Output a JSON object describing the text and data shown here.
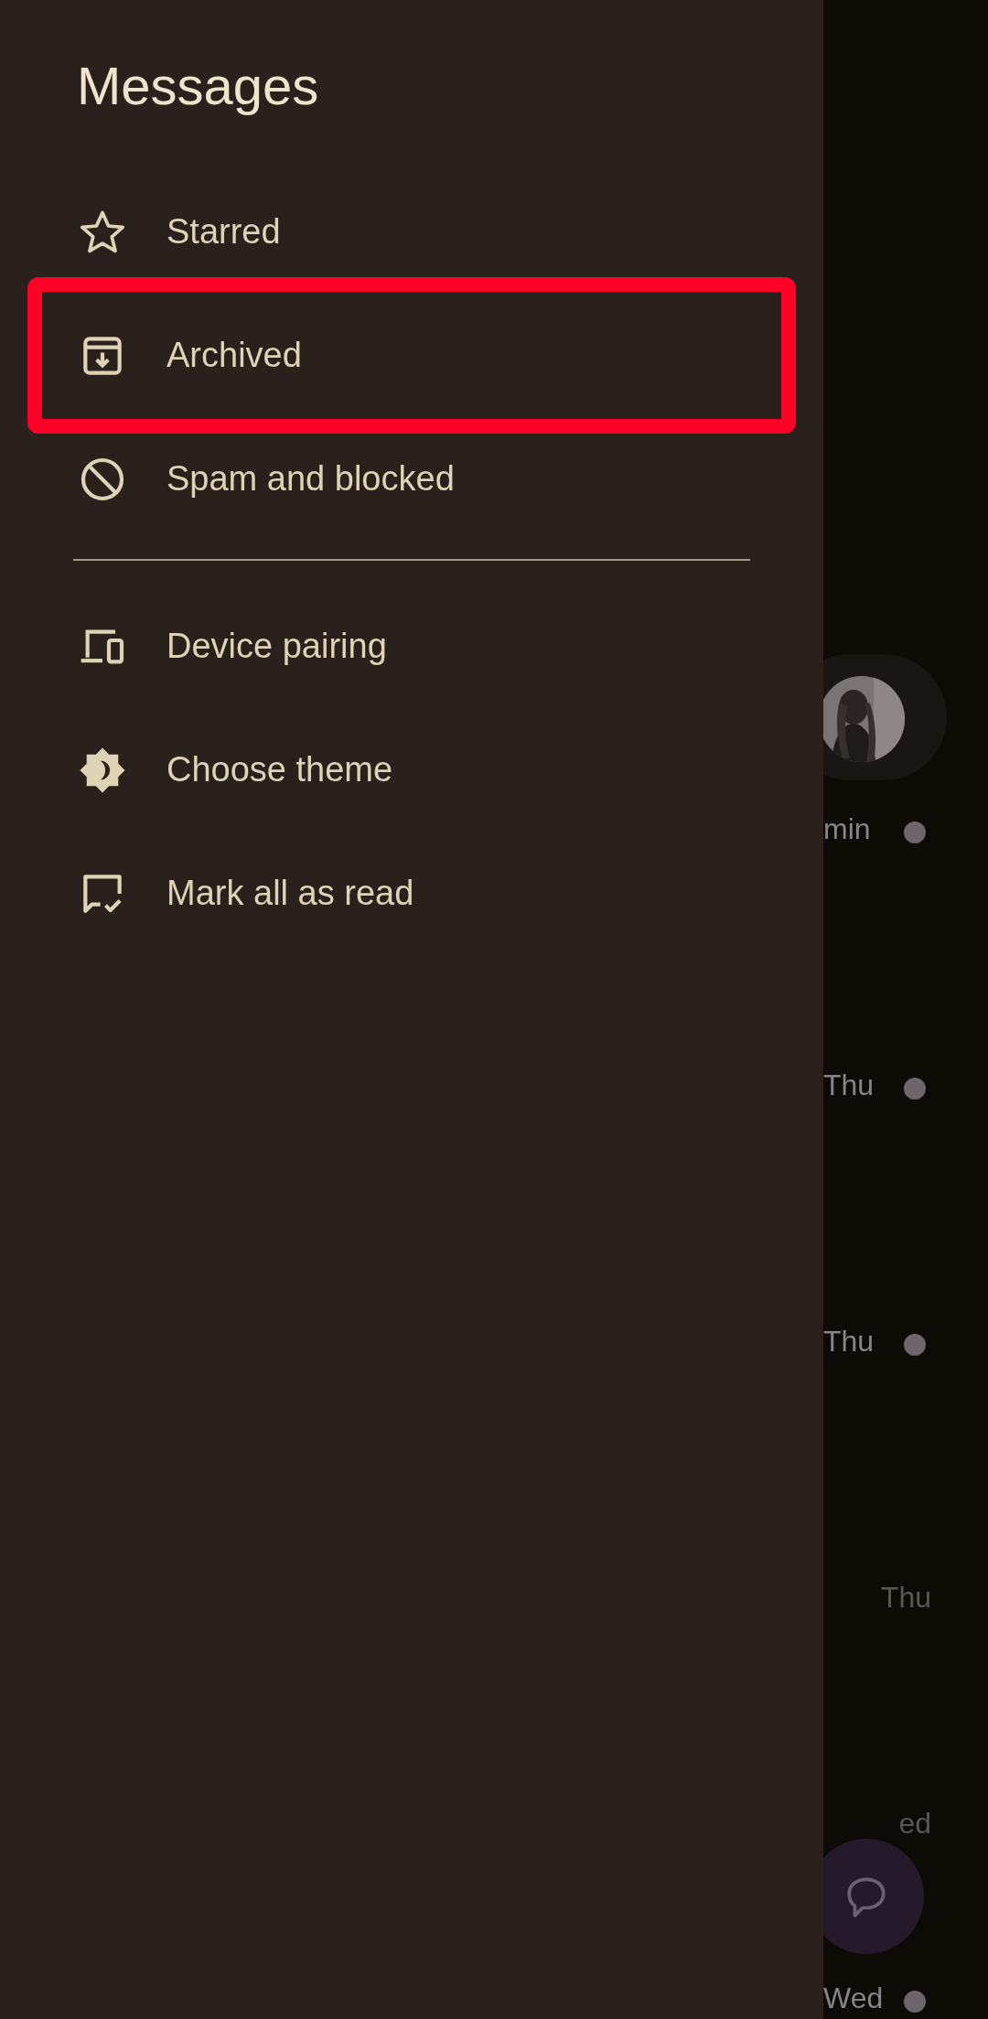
{
  "drawer": {
    "title": "Messages",
    "groups": [
      [
        {
          "label": "Starred",
          "highlighted": false
        },
        {
          "label": "Archived",
          "highlighted": true
        },
        {
          "label": "Spam and blocked",
          "highlighted": false
        }
      ],
      [
        {
          "label": "Device pairing",
          "highlighted": false
        },
        {
          "label": "Choose theme",
          "highlighted": false
        },
        {
          "label": "Mark all as read",
          "highlighted": false
        }
      ]
    ]
  },
  "conversations": [
    {
      "time": "min",
      "unread": true
    },
    {
      "time": "Thu",
      "unread": true
    },
    {
      "time": "Thu",
      "unread": true
    },
    {
      "time": "Thu",
      "unread": false
    },
    {
      "time": "ed",
      "unread": false
    },
    {
      "time": "Wed",
      "unread": true
    }
  ]
}
